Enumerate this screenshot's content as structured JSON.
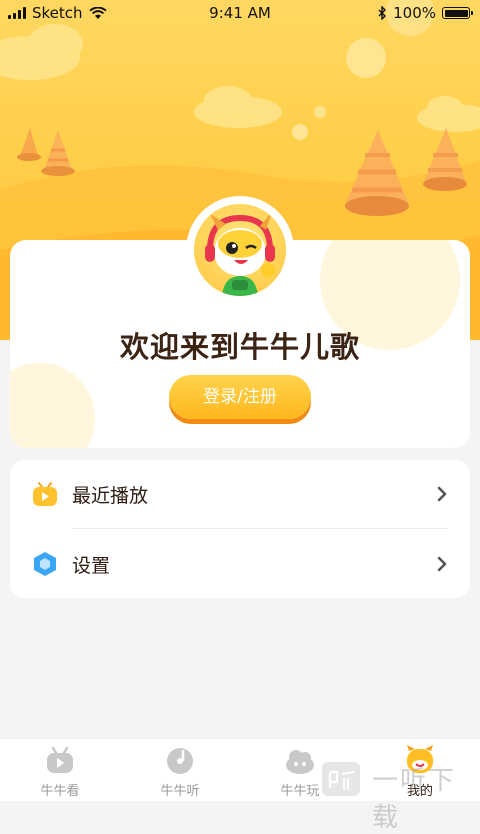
{
  "status_bar": {
    "carrier": "Sketch",
    "time": "9:41 AM",
    "battery": "100%"
  },
  "profile": {
    "welcome_text": "欢迎来到牛牛儿歌",
    "login_button": "登录/注册",
    "avatar": "cartoon-calf-with-headphones"
  },
  "menu": {
    "items": [
      {
        "label": "最近播放",
        "icon": "play-tv-icon"
      },
      {
        "label": "设置",
        "icon": "hexagon-settings-icon"
      }
    ]
  },
  "tabbar": {
    "tabs": [
      {
        "label": "牛牛看",
        "icon": "tv-icon",
        "active": false
      },
      {
        "label": "牛牛听",
        "icon": "music-disc-icon",
        "active": false
      },
      {
        "label": "牛牛玩",
        "icon": "play-cloud-icon",
        "active": false
      },
      {
        "label": "我的",
        "icon": "calf-face-icon",
        "active": true
      }
    ]
  },
  "watermark": {
    "text": "一听下载"
  },
  "colors": {
    "accent": "#ffb81e",
    "header_bg": "#ffcf4a",
    "text_dark": "#3b2414",
    "tab_inactive": "#9b9b9b"
  }
}
